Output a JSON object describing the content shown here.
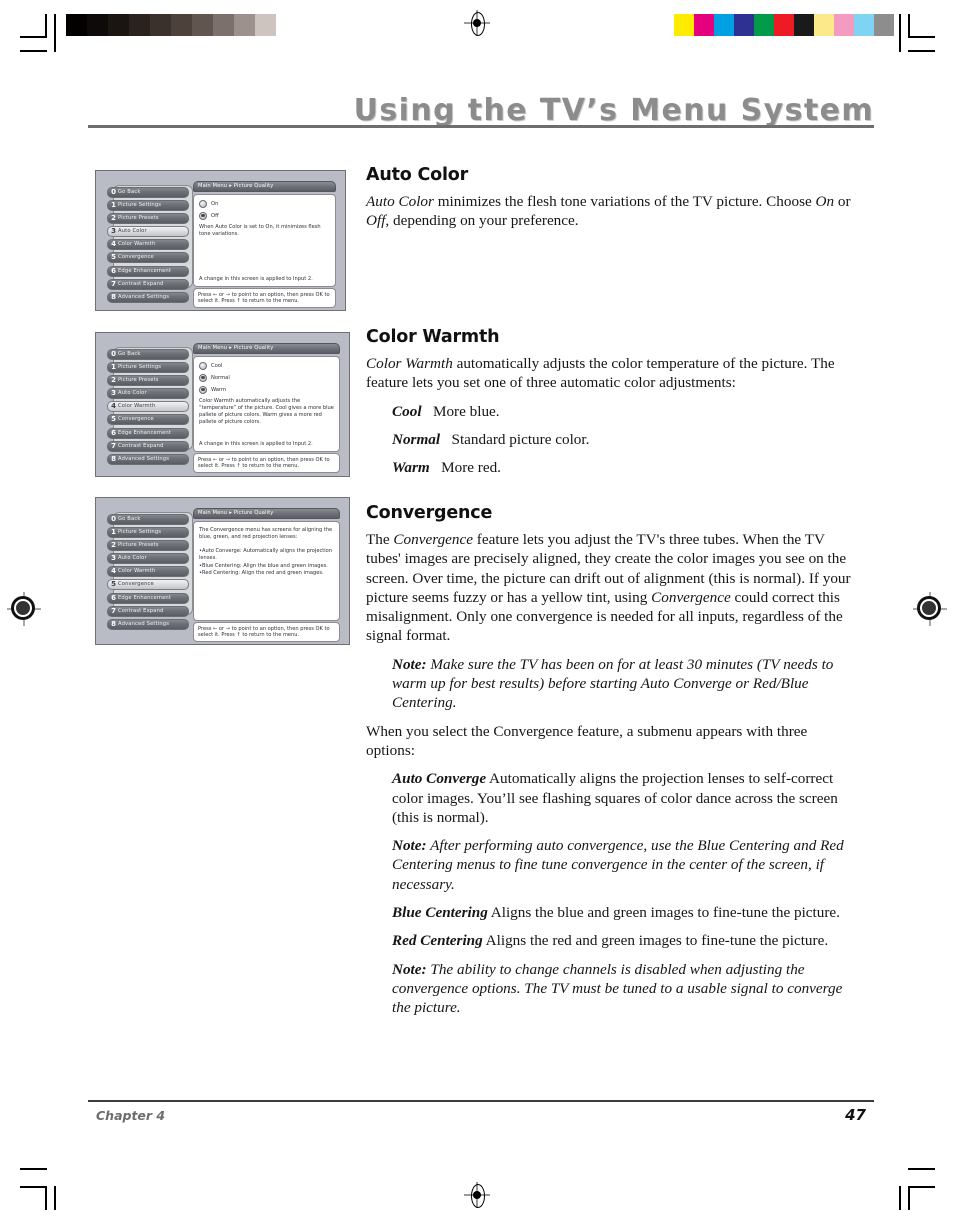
{
  "header": {
    "title": "Using the TV’s Menu System"
  },
  "footer": {
    "chapter": "Chapter 4",
    "page_number": "47"
  },
  "registration": {
    "grayscale_swatches": [
      "#030100",
      "#0e0a09",
      "#1b1512",
      "#2a221e",
      "#3b312c",
      "#4c413b",
      "#615550",
      "#7b706b",
      "#9c918c",
      "#cdc4c0",
      "#ffffff"
    ],
    "color_swatches": [
      "#fdec00",
      "#e5007d",
      "#00a0e3",
      "#2e3191",
      "#009a49",
      "#ed1c24",
      "#1a1a1a",
      "#fbe98a",
      "#f49bc1",
      "#7fd4f4",
      "#8d8d8d"
    ]
  },
  "screenshots": [
    {
      "name": "auto-color-menu",
      "breadcrumb_root": "Main Menu",
      "breadcrumb_leaf": "Picture Quality",
      "selected_index": 3,
      "menu_items": [
        {
          "num": "0",
          "label": "Go Back"
        },
        {
          "num": "1",
          "label": "Picture Settings"
        },
        {
          "num": "2",
          "label": "Picture Presets"
        },
        {
          "num": "3",
          "label": "Auto Color"
        },
        {
          "num": "4",
          "label": "Color Warmth"
        },
        {
          "num": "5",
          "label": "Convergence"
        },
        {
          "num": "6",
          "label": "Edge Enhancement"
        },
        {
          "num": "7",
          "label": "Contrast Expand"
        },
        {
          "num": "8",
          "label": "Advanced Settings"
        }
      ],
      "options": [
        {
          "label": "On",
          "selected": false
        },
        {
          "label": "Off",
          "selected": true
        }
      ],
      "description": "When Auto Color is set to On, it minimizes flesh tone variations.",
      "applied_note": "A change in this screen is applied to Input 2.",
      "hint": "Press ← or → to point to an option, then press OK to select it. Press ↑ to return to the menu."
    },
    {
      "name": "color-warmth-menu",
      "breadcrumb_root": "Main Menu",
      "breadcrumb_leaf": "Picture Quality",
      "selected_index": 4,
      "menu_items": [
        {
          "num": "0",
          "label": "Go Back"
        },
        {
          "num": "1",
          "label": "Picture Settings"
        },
        {
          "num": "2",
          "label": "Picture Presets"
        },
        {
          "num": "3",
          "label": "Auto Color"
        },
        {
          "num": "4",
          "label": "Color Warmth"
        },
        {
          "num": "5",
          "label": "Convergence"
        },
        {
          "num": "6",
          "label": "Edge Enhancement"
        },
        {
          "num": "7",
          "label": "Contrast Expand"
        },
        {
          "num": "8",
          "label": "Advanced Settings"
        }
      ],
      "options": [
        {
          "label": "Cool",
          "selected": false
        },
        {
          "label": "Normal",
          "selected": true
        },
        {
          "label": "Warm",
          "selected": true
        }
      ],
      "description": "Color Warmth automatically adjusts the “temperature” of the picture. Cool gives a more blue pallete of picture colors. Warm gives a more red pallete of picture colors.",
      "applied_note": "A change in this screen is applied to Input 2.",
      "hint": "Press ← or → to point to an option, then press OK to select it. Press ↑ to return to the menu."
    },
    {
      "name": "convergence-menu",
      "breadcrumb_root": "Main Menu",
      "breadcrumb_leaf": "Picture Quality",
      "selected_index": 5,
      "menu_items": [
        {
          "num": "0",
          "label": "Go Back"
        },
        {
          "num": "1",
          "label": "Picture Settings"
        },
        {
          "num": "2",
          "label": "Picture Presets"
        },
        {
          "num": "3",
          "label": "Auto Color"
        },
        {
          "num": "4",
          "label": "Color Warmth"
        },
        {
          "num": "5",
          "label": "Convergence"
        },
        {
          "num": "6",
          "label": "Edge Enhancement"
        },
        {
          "num": "7",
          "label": "Contrast Expand"
        },
        {
          "num": "8",
          "label": "Advanced Settings"
        }
      ],
      "description": "The Convergence menu has screens for aligning the blue, green, and red projection lenses:",
      "bullets": [
        "•Auto Converge: Automatically aligns the projection lenses.",
        "•Blue Centering: Align the blue and green images.",
        "•Red Centering: Align the red and green images."
      ],
      "hint": "Press ← or → to point to an option, then press OK to select it. Press ↑ to return to the menu."
    }
  ],
  "sections": {
    "auto_color": {
      "heading": "Auto Color",
      "para_1_a": "Auto Color",
      "para_1_b": " minimizes the flesh tone variations of the TV picture. Choose ",
      "para_1_c": "On",
      "para_1_d": " or ",
      "para_1_e": "Off",
      "para_1_f": ", depending on your preference."
    },
    "color_warmth": {
      "heading": "Color Warmth",
      "para_1_a": "Color Warmth",
      "para_1_b": " automatically adjusts the color temperature of the picture. The feature lets you set one of three automatic color adjustments:",
      "items": [
        {
          "term": "Cool",
          "desc": "More blue."
        },
        {
          "term": "Normal",
          "desc": "Standard picture color."
        },
        {
          "term": "Warm",
          "desc": "More red."
        }
      ]
    },
    "convergence": {
      "heading": "Convergence",
      "para_1_a": "The ",
      "para_1_b": "Convergence",
      "para_1_c": " feature lets you adjust the TV's three tubes. When the TV tubes' images are precisely aligned, they create the color images you see on the screen. Over time, the picture can drift out of alignment (this is normal). If your picture seems fuzzy or has a yellow tint, using ",
      "para_1_d": "Convergence",
      "para_1_e": " could correct this misalignment. Only one convergence is needed for all inputs, regardless of the signal format.",
      "note_1_label": "Note:",
      "note_1_text": " Make sure the TV has been on for at least 30 minutes (TV needs to warm up for best results) before starting Auto Converge or Red/Blue Centering.",
      "para_2": "When you select the Convergence feature, a submenu appears with three options:",
      "item_auto_label": "Auto Converge",
      "item_auto_text": "  Automatically aligns the projection lenses to self-correct color images. You’ll see flashing squares of color dance across the screen (this is normal).",
      "note_2_label": "Note:",
      "note_2_text": " After performing auto convergence, use the Blue Centering and Red Centering menus to fine tune convergence in the center of the screen, if necessary.",
      "item_blue_label": "Blue Centering",
      "item_blue_text": "  Aligns the blue and green images to fine-tune the picture.",
      "item_red_label": "Red Centering",
      "item_red_text": "  Aligns the red and green images to fine-tune the picture.",
      "note_3_label": "Note:",
      "note_3_text": " The ability to change channels is disabled when adjusting the convergence options. The TV must be tuned to a usable signal to converge the picture."
    }
  }
}
